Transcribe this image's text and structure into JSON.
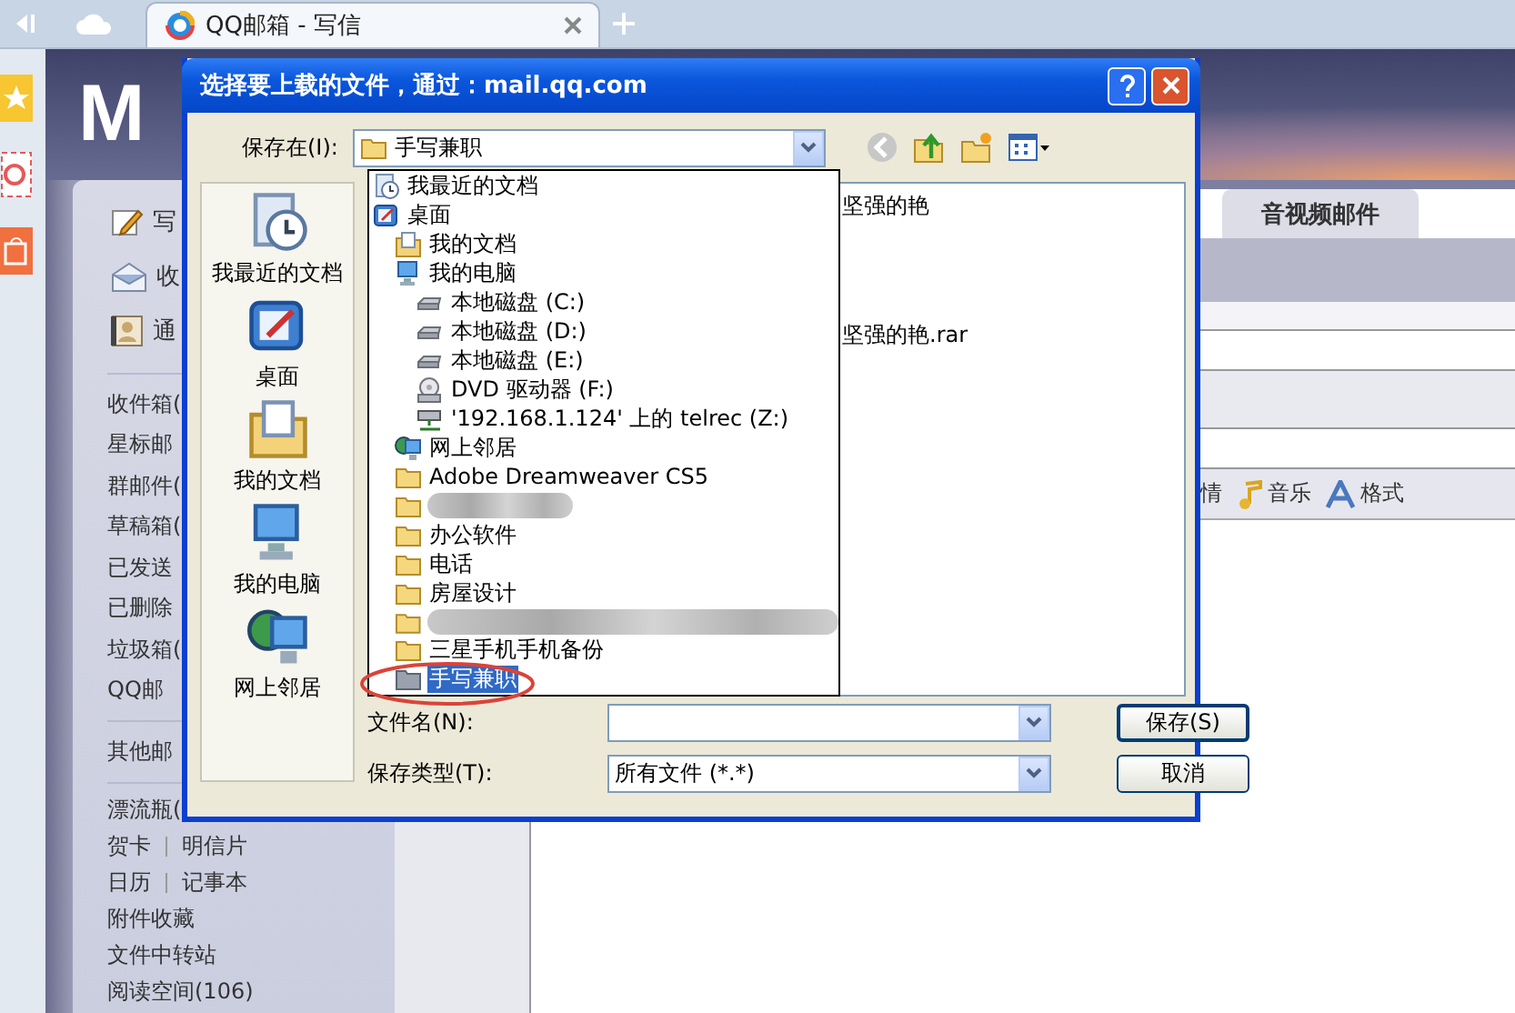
{
  "browser": {
    "tabs": [
      {
        "title": "QQ邮箱 - 写信",
        "selected": true
      }
    ]
  },
  "mail": {
    "logo": "M",
    "quick_actions": [
      {
        "label": "写",
        "kind": "compose"
      },
      {
        "label": "收",
        "kind": "inbox"
      },
      {
        "label": "通",
        "kind": "contacts"
      }
    ],
    "folder_groups": [
      [
        [
          "收件箱("
        ],
        [
          "星标邮"
        ],
        [
          "群邮件("
        ],
        [
          "草稿箱("
        ],
        [
          "已发送"
        ],
        [
          "已删除"
        ],
        [
          "垃圾箱("
        ],
        [
          "QQ邮"
        ]
      ],
      [
        [
          "其他邮"
        ]
      ],
      [
        [
          "漂流瓶("
        ],
        [
          "贺卡",
          "明信片"
        ],
        [
          "日历",
          "记事本"
        ],
        [
          "附件收藏"
        ],
        [
          "文件中转站"
        ],
        [
          "阅读空间(106)"
        ]
      ]
    ],
    "tabs": [
      {
        "label": "音视频邮件",
        "selected": false
      }
    ],
    "toolbar": [
      {
        "label": "情",
        "kind": "plain"
      },
      {
        "label": "音乐",
        "kind": "music"
      },
      {
        "label": "格式",
        "kind": "format"
      }
    ]
  },
  "dialog": {
    "title": "选择要上载的文件，通过：mail.qq.com",
    "save_in": {
      "label": "保存在(I):",
      "value": "手写兼职"
    },
    "places": [
      {
        "label": "我最近的文档",
        "kind": "recent"
      },
      {
        "label": "桌面",
        "kind": "desktop"
      },
      {
        "label": "我的文档",
        "kind": "documents"
      },
      {
        "label": "我的电脑",
        "kind": "computer"
      },
      {
        "label": "网上邻居",
        "kind": "network"
      }
    ],
    "files": [
      "坚强的艳",
      "坚强的艳.rar"
    ],
    "dropdown": [
      {
        "label": "我最近的文档",
        "kind": "recent",
        "selected": false
      },
      {
        "label": "桌面",
        "kind": "desktop",
        "selected": false,
        "children": [
          {
            "label": "我的文档",
            "kind": "documents",
            "selected": false
          },
          {
            "label": "我的电脑",
            "kind": "computer",
            "selected": false,
            "children": [
              {
                "label": "本地磁盘 (C:)",
                "kind": "disk",
                "selected": false
              },
              {
                "label": "本地磁盘 (D:)",
                "kind": "disk",
                "selected": false
              },
              {
                "label": "本地磁盘 (E:)",
                "kind": "disk",
                "selected": false
              },
              {
                "label": "DVD 驱动器 (F:)",
                "kind": "dvd",
                "selected": false
              },
              {
                "label": "'192.168.1.124' 上的 telrec (Z:)",
                "kind": "netdrive",
                "selected": false
              }
            ]
          },
          {
            "label": "网上邻居",
            "kind": "network",
            "selected": false
          },
          {
            "label": "Adobe Dreamweaver CS5",
            "kind": "folder",
            "selected": false
          },
          {
            "kind": "redacted",
            "selected": false
          },
          {
            "label": "办公软件",
            "kind": "folder",
            "selected": false
          },
          {
            "label": "电话",
            "kind": "folder",
            "selected": false
          },
          {
            "label": "房屋设计",
            "kind": "folder",
            "selected": false
          },
          {
            "kind": "redacted",
            "selected": false
          },
          {
            "label": "三星手机手机备份",
            "kind": "folder",
            "selected": false
          },
          {
            "label": "手写兼职",
            "kind": "folder",
            "selected": true
          }
        ]
      }
    ],
    "file_name": {
      "label": "文件名(N):"
    },
    "file_type": {
      "label": "保存类型(T):",
      "value": "所有文件 (*.*)"
    },
    "buttons": [
      "保存(S)",
      "取消"
    ]
  }
}
